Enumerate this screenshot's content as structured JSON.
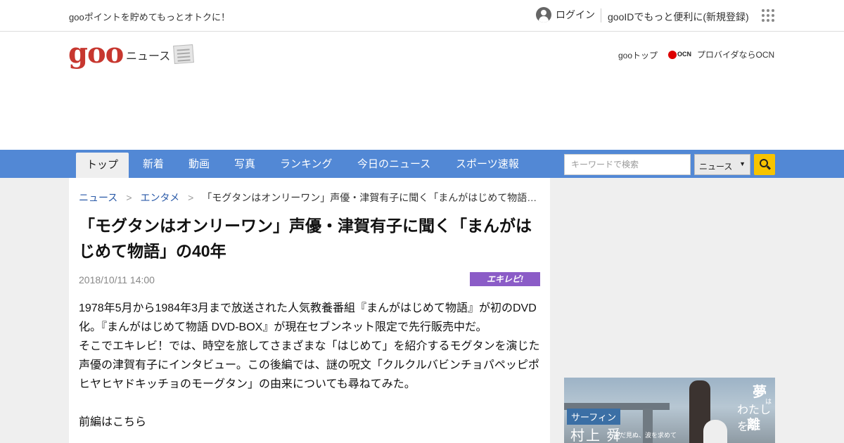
{
  "topbar": {
    "promo": "gooポイントを貯めてもっとオトクに！",
    "login": "ログイン",
    "register": "gooIDでもっと便利に(新規登録)"
  },
  "header": {
    "logo": "goo",
    "section": "ニュース",
    "goo_top": "gooトップ",
    "ocn_logo": "OCN",
    "ocn_text": "プロバイダならOCN"
  },
  "nav": {
    "tabs": [
      {
        "label": "トップ",
        "active": true
      },
      {
        "label": "新着"
      },
      {
        "label": "動画"
      },
      {
        "label": "写真"
      },
      {
        "label": "ランキング"
      },
      {
        "label": "今日のニュース"
      },
      {
        "label": "スポーツ速報"
      }
    ],
    "search_placeholder": "キーワードで検索",
    "search_scope": "ニュース"
  },
  "article": {
    "breadcrumb": [
      "ニュース",
      "エンタメ",
      "「モグタンはオンリーワン」声優・津賀有子に聞く「まんがはじめて物語…"
    ],
    "title": "「モグタンはオンリーワン」声優・津賀有子に聞く「まんがはじめて物語」の40年",
    "date": "2018/10/11 14:00",
    "source": "エキレビ!",
    "paragraphs": [
      "1978年5月から1984年3月まで放送された人気教養番組『まんがはじめて物語』が初のDVD化。『まんがはじめて物語 DVD-BOX』が現在セブンネット限定で先行販売中だ。",
      "そこでエキレビ！では、時空を旅してさまざまな「はじめて」を紹介するモグタンを演じた声優の津賀有子にインタビュー。この後編では、謎の呪文「クルクルバビンチョパペッピポ　ヒヤヒヤドキッチョのモーグタン」の由来についても尋ねてみた。",
      "前編はこちら"
    ]
  },
  "ad": {
    "tag": "サーフィン",
    "name": "村上 舜",
    "sub": "まだ見ぬ、波を求めて",
    "catch1": "夢",
    "catch_small": "は",
    "catch2": "わたしを",
    "catch3": "離"
  }
}
